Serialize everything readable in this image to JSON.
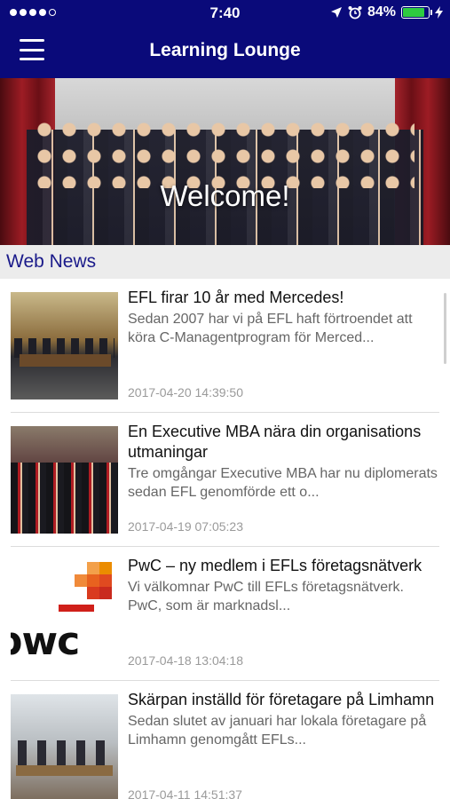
{
  "status_bar": {
    "time": "7:40",
    "battery": "84%",
    "battery_level": 0.84,
    "signal_bars_filled": 4,
    "signal_bars_total": 5
  },
  "header": {
    "title": "Learning Lounge",
    "menu_icon": "hamburger-menu-icon"
  },
  "hero": {
    "caption": "Welcome!"
  },
  "section": {
    "title": "Web News"
  },
  "news": [
    {
      "title": "EFL firar 10 år med Mercedes!",
      "excerpt": "Sedan 2007 har vi på EFL haft förtroendet att köra C-Managentprogram för Merced...",
      "date": "2017-04-20 14:39:50"
    },
    {
      "title": "En Executive MBA nära din organisations utmaningar",
      "excerpt": "Tre omgångar Executive MBA har nu diplomerats sedan EFL genomförde ett o...",
      "date": "2017-04-19 07:05:23"
    },
    {
      "title": "PwC – ny medlem i EFLs företagsnätverk",
      "excerpt": "Vi välkomnar PwC till EFLs företagsnätverk. PwC, som är marknadsl...",
      "date": "2017-04-18 13:04:18",
      "logo_text": "pwc"
    },
    {
      "title": "Skärpan inställd för företagare på Limhamn",
      "excerpt": "Sedan slutet av januari har lokala företagare på Limhamn genomgått EFLs...",
      "date": "2017-04-11 14:51:37"
    }
  ]
}
